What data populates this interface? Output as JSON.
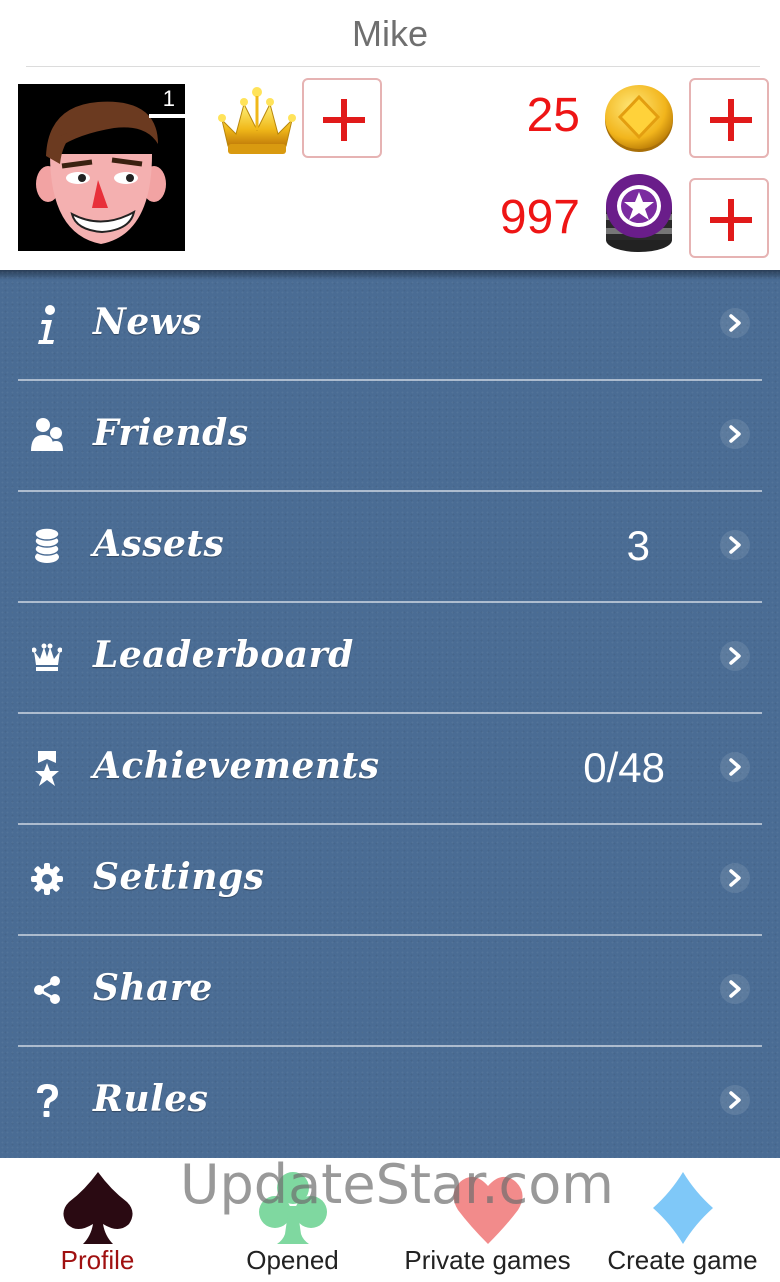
{
  "header": {
    "username": "Mike"
  },
  "profile": {
    "avatar_level": "1"
  },
  "currencies": {
    "coins": {
      "value": "25",
      "icon": "gold-coin-icon",
      "add_icon": "plus-icon"
    },
    "chips": {
      "value": "997",
      "icon": "poker-chip-icon",
      "add_icon": "plus-icon"
    }
  },
  "menu": {
    "items": [
      {
        "label": "News",
        "icon": "info-icon",
        "value": ""
      },
      {
        "label": "Friends",
        "icon": "friends-icon",
        "value": ""
      },
      {
        "label": "Assets",
        "icon": "coins-stack-icon",
        "value": "3"
      },
      {
        "label": "Leaderboard",
        "icon": "crown-icon",
        "value": ""
      },
      {
        "label": "Achievements",
        "icon": "ribbon-star-icon",
        "value": "0/48"
      },
      {
        "label": "Settings",
        "icon": "gear-icon",
        "value": ""
      },
      {
        "label": "Share",
        "icon": "share-icon",
        "value": ""
      },
      {
        "label": "Rules",
        "icon": "question-icon",
        "value": ""
      }
    ]
  },
  "tabs": [
    {
      "label": "Profile",
      "icon": "spade-icon",
      "active": true
    },
    {
      "label": "Opened",
      "icon": "club-icon",
      "active": false
    },
    {
      "label": "Private games",
      "icon": "heart-icon",
      "active": false
    },
    {
      "label": "Create game",
      "icon": "diamond-icon",
      "active": false
    }
  ],
  "watermark": "UpdateStar.com",
  "colors": {
    "menu_background": "#4a6c94",
    "currency_red": "#ee1515",
    "active_tab": "#a01010",
    "spade": "#2a0a12",
    "club": "#7fd8a0",
    "heart": "#f28b8b",
    "diamond": "#7fc8f8"
  }
}
